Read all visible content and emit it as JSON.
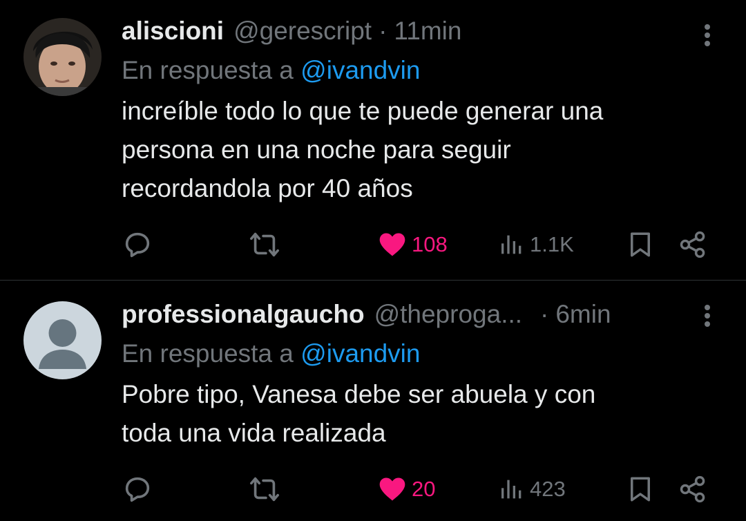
{
  "colors": {
    "background": "#000000",
    "primary_text": "#e7e9ea",
    "secondary_text": "#71767b",
    "mention": "#1d9bf0",
    "like": "#f91880",
    "divider": "#2f3336"
  },
  "tweets": [
    {
      "display_name": "aliscioni",
      "handle": "@gerescript",
      "separator": "·",
      "time": "11min",
      "reply_prefix": "En respuesta a",
      "reply_to": "@ivandvin",
      "text": "increíble todo lo que te puede generar una\npersona en una noche para seguir\nrecordandola por 40 años",
      "liked": true,
      "counts": {
        "replies": "",
        "reposts": "",
        "likes": "108",
        "views": "1.1K"
      },
      "icons": [
        "reply-icon",
        "repost-icon",
        "heart-icon",
        "views-icon",
        "bookmark-icon",
        "share-icon",
        "more-icon"
      ]
    },
    {
      "display_name": "professionalgaucho",
      "handle": "@theproga...",
      "separator": "·",
      "time": "6min",
      "reply_prefix": "En respuesta a",
      "reply_to": "@ivandvin",
      "text": "Pobre tipo, Vanesa debe ser abuela y con\ntoda una vida realizada",
      "liked": true,
      "counts": {
        "replies": "",
        "reposts": "",
        "likes": "20",
        "views": "423"
      },
      "icons": [
        "reply-icon",
        "repost-icon",
        "heart-icon",
        "views-icon",
        "bookmark-icon",
        "share-icon",
        "more-icon"
      ]
    }
  ]
}
